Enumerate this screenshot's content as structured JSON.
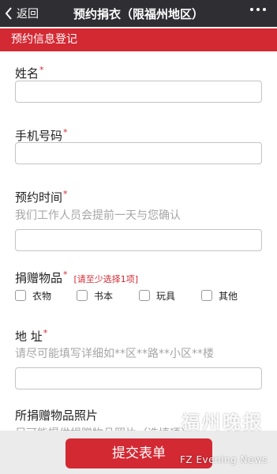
{
  "navbar": {
    "back_label": "返回",
    "title": "预约捐衣（限福州地区）"
  },
  "section_header": "预约信息登记",
  "fields": {
    "name": {
      "label": "姓名",
      "required_mark": "*"
    },
    "phone": {
      "label": "手机号码",
      "required_mark": "*"
    },
    "appointment_time": {
      "label": "预约时间",
      "required_mark": "*",
      "hint": "我们工作人员会提前一天与您确认"
    },
    "donation_items": {
      "label": "捐赠物品",
      "required_mark": "*",
      "warning": "[请至少选择1项]",
      "options": [
        "衣物",
        "书本",
        "玩具",
        "其他"
      ]
    },
    "address": {
      "label": "地 址",
      "required_mark": "*",
      "hint": "请尽可能填写详细如**区**路**小区**楼"
    },
    "photos": {
      "label": "所捐赠物品照片",
      "hint": "尽可能提供捐赠物品照片（选填项）"
    }
  },
  "submit_label": "提交表单",
  "watermark": {
    "chinese": "福州晚报",
    "english": "FZ Evening News"
  }
}
